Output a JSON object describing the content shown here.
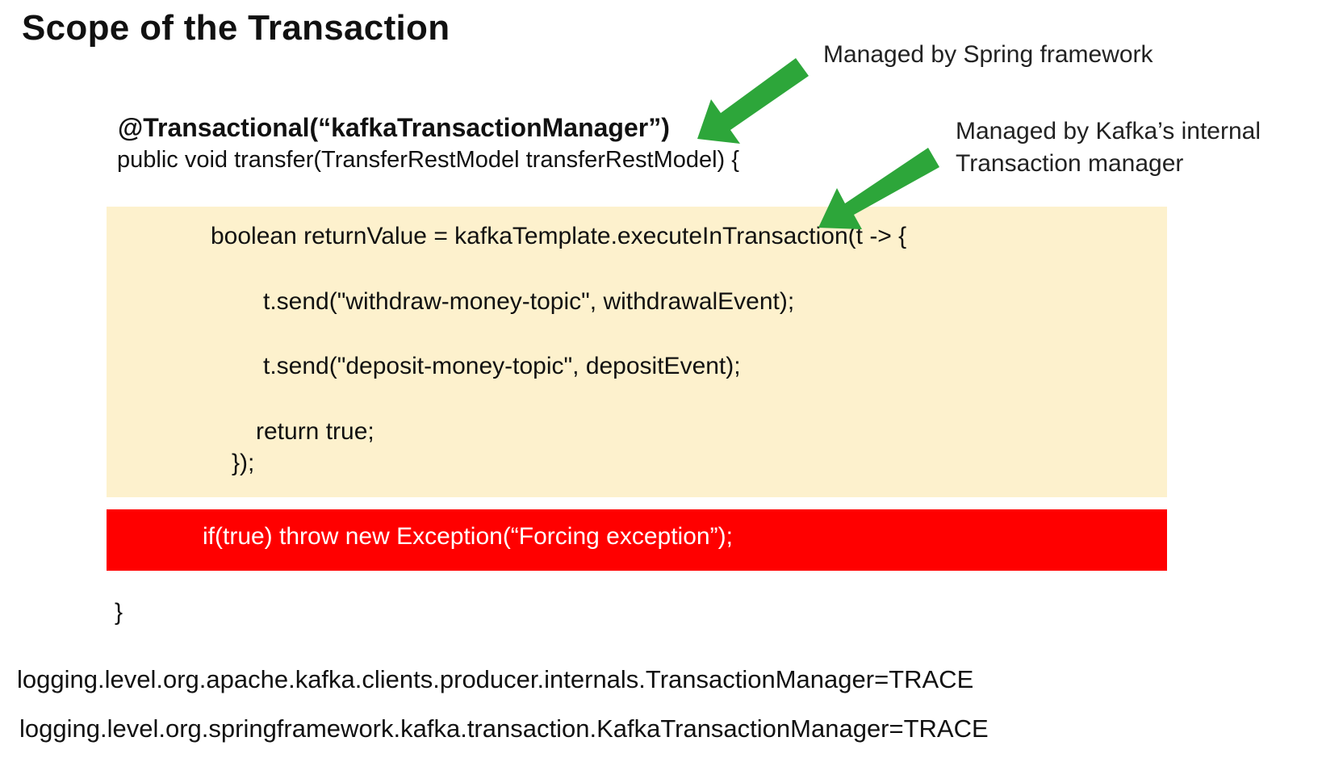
{
  "slide": {
    "title": "Scope of the Transaction"
  },
  "annotations": {
    "spring": "Managed by Spring framework",
    "kafka": "Managed by Kafka’s internal Transaction manager"
  },
  "code": {
    "decorator": "@Transactional(“kafkaTransactionManager”)",
    "signature": "public void transfer(TransferRestModel transferRestModel)  {",
    "transaction_block": [
      "boolean returnValue = kafkaTemplate.executeInTransaction(t -> {",
      "t.send(\"withdraw-money-topic\", withdrawalEvent);",
      "t.send(\"deposit-money-topic\", depositEvent);",
      "return true;",
      "});"
    ],
    "exception_line": "if(true) throw new Exception(“Forcing exception”);",
    "closing_brace": "}"
  },
  "properties": [
    "logging.level.org.apache.kafka.clients.producer.internals.TransactionManager=TRACE",
    "logging.level.org.springframework.kafka.transaction.KafkaTransactionManager=TRACE"
  ],
  "colors": {
    "transaction_block": "#fdf1cd",
    "exception_block": "#ff0000",
    "arrow": "#2da63a"
  },
  "icons": [
    "arrow-spring-icon",
    "arrow-kafka-icon"
  ]
}
